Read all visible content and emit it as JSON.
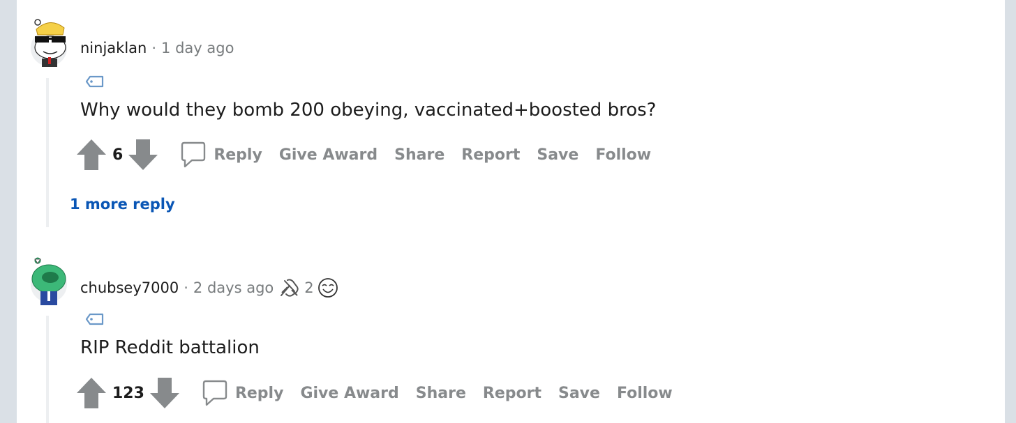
{
  "comments": [
    {
      "author": "ninjaklan",
      "separator": "·",
      "time": "1 day ago",
      "body": "Why would they bomb 200 obeying, vaccinated+boosted bros?",
      "score": "6",
      "actions": {
        "reply": "Reply",
        "give_award": "Give Award",
        "share": "Share",
        "report": "Report",
        "save": "Save",
        "follow": "Follow"
      },
      "more_replies": "1 more reply"
    },
    {
      "author": "chubsey7000",
      "separator": "·",
      "time": "2 days ago",
      "award_count": "2",
      "body": "RIP Reddit battalion",
      "score": "123",
      "actions": {
        "reply": "Reply",
        "give_award": "Give Award",
        "share": "Share",
        "report": "Report",
        "save": "Save",
        "follow": "Follow"
      }
    }
  ],
  "icons": {
    "upvote": "upvote-arrow-icon",
    "downvote": "downvote-arrow-icon",
    "reply": "speech-bubble-icon",
    "flair": "tag-icon",
    "award_1": "crossed-hands-award-icon",
    "award_2": "laughing-face-award-icon"
  },
  "colors": {
    "background": "#dae0e6",
    "panel": "#ffffff",
    "action_text": "#878a8c",
    "vote_arrow": "#878a8c",
    "link": "#0a56b5",
    "flair_icon": "#6a98c8"
  }
}
